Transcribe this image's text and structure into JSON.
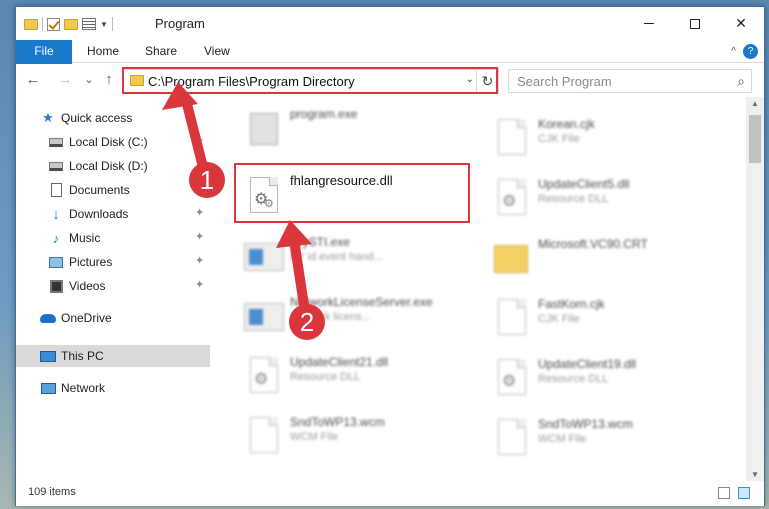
{
  "window": {
    "title": "Program",
    "controls": {
      "minimize": "",
      "maximize": "",
      "close": "✕"
    }
  },
  "ribbon": {
    "tabs": [
      "File",
      "Home",
      "Share",
      "View"
    ],
    "help": "?",
    "collapse": "^"
  },
  "nav": {
    "back": "←",
    "forward": "→",
    "recent": "⌄",
    "up": "↑",
    "address": "C:\\Program Files\\Program Directory",
    "address_dropdown": "⌄",
    "refresh": "↻",
    "search_placeholder": "Search Program",
    "search_glyph": "⌕"
  },
  "sidebar": {
    "items": [
      {
        "label": "Quick access",
        "icon": "star-icon",
        "pinned": false
      },
      {
        "label": "Local Disk (C:)",
        "icon": "disk-icon",
        "pinned": true
      },
      {
        "label": "Local Disk (D:)",
        "icon": "disk-icon",
        "pinned": false
      },
      {
        "label": "Documents",
        "icon": "documents-icon",
        "pinned": true
      },
      {
        "label": "Downloads",
        "icon": "downloads-icon",
        "pinned": true
      },
      {
        "label": "Music",
        "icon": "music-icon",
        "pinned": true
      },
      {
        "label": "Pictures",
        "icon": "pictures-icon",
        "pinned": true
      },
      {
        "label": "Videos",
        "icon": "videos-icon",
        "pinned": true
      },
      {
        "label": "OneDrive",
        "icon": "onedrive-icon",
        "pinned": false
      },
      {
        "label": "This PC",
        "icon": "this-pc-icon",
        "pinned": false,
        "selected": true
      },
      {
        "label": "Network",
        "icon": "network-icon",
        "pinned": false
      }
    ]
  },
  "files": {
    "highlighted": {
      "name": "fhlangresource.dll"
    },
    "blurred": [
      {
        "name": "program.exe",
        "type": ""
      },
      {
        "name": "Korean.cjk",
        "type": "CJK File"
      },
      {
        "name": "UpdateClient5.dll",
        "type": "Resource DLL"
      },
      {
        "name": "byySTI.exe",
        "type": "BY id event hand..."
      },
      {
        "name": "Microsoft.VC90.CRT",
        "type": ""
      },
      {
        "name": "NetworkLicenseServer.exe",
        "type": "Network licens..."
      },
      {
        "name": "FastKorn.cjk",
        "type": "CJK File"
      },
      {
        "name": "UpdateClient21.dll",
        "type": "Resource DLL"
      },
      {
        "name": "UpdateClient19.dll",
        "type": "Resource DLL"
      },
      {
        "name": "SndToWP13.wcm",
        "type": "WCM File"
      },
      {
        "name": "SndToWP13.wcm",
        "type": "WCM File"
      }
    ]
  },
  "status": {
    "count": "109 items"
  },
  "annotations": {
    "step1": "1",
    "step2": "2"
  },
  "colors": {
    "accent": "#1979ca",
    "highlight": "#d9373b",
    "annotation": "#d9373b"
  }
}
